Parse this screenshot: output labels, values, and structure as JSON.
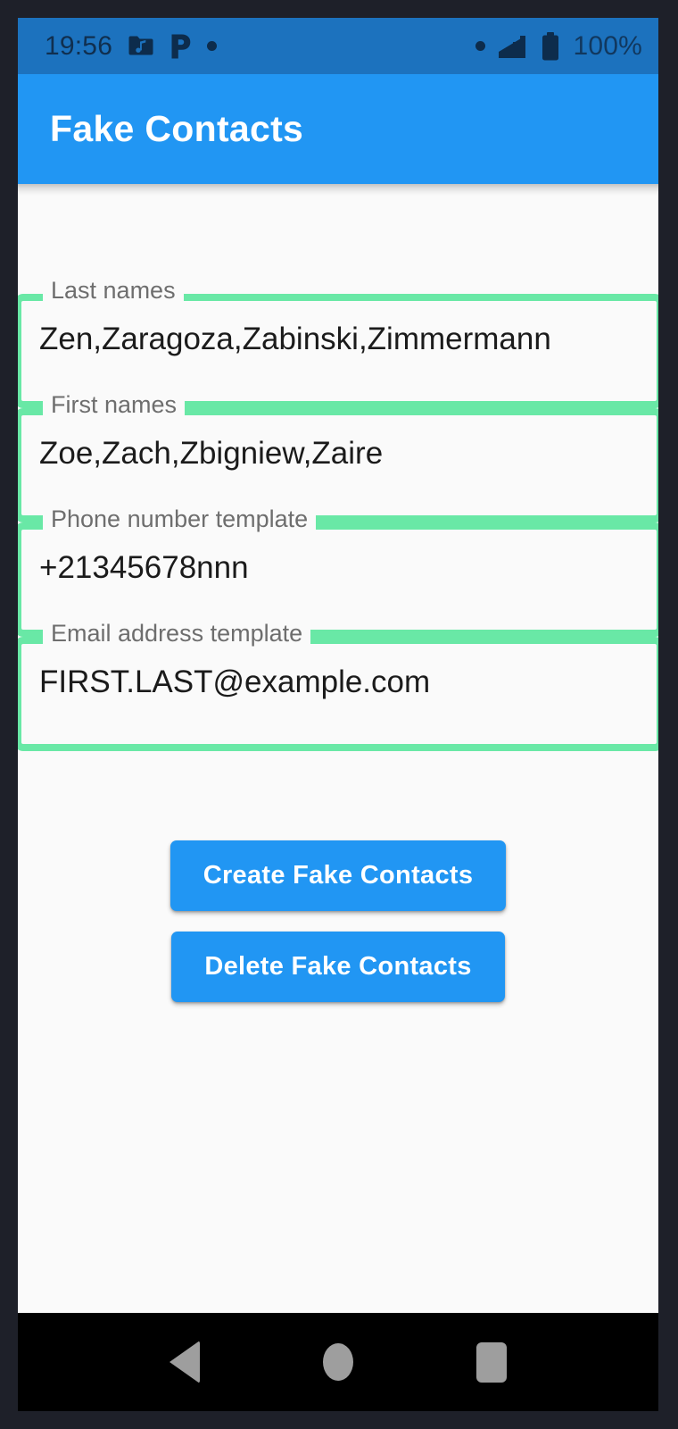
{
  "status_bar": {
    "clock": "19:56",
    "battery_percent": "100%",
    "left_icons": [
      "music-folder-icon",
      "pandora-p-icon",
      "notification-dot-icon"
    ],
    "right_icons": [
      "notification-dot-icon",
      "signal-bars-icon",
      "battery-full-icon"
    ],
    "background_color": "#1C72BE",
    "foreground_color": "#0D2C4C"
  },
  "app_bar": {
    "title": "Fake Contacts",
    "background_color": "#2196F3",
    "title_color": "#FFFFFF"
  },
  "form": {
    "accent_color": "#69E8A6",
    "label_color": "#6E6E6E",
    "fields": [
      {
        "id": "last-names",
        "label": "Last names",
        "value": "Zen,Zaragoza,Zabinski,Zimmermann",
        "placeholder": "Last names"
      },
      {
        "id": "first-names",
        "label": "First names",
        "value": "Zoe,Zach,Zbigniew,Zaire",
        "placeholder": "First names"
      },
      {
        "id": "phone-template",
        "label": "Phone number template",
        "value": "+21345678nnn",
        "placeholder": "Phone number template"
      },
      {
        "id": "email-template",
        "label": "Email address template",
        "value": "FIRST.LAST@example.com",
        "placeholder": "Email address template"
      }
    ]
  },
  "buttons": {
    "create_label": "Create Fake Contacts",
    "delete_label": "Delete Fake Contacts",
    "background_color": "#2196F3",
    "text_color": "#FFFFFF"
  },
  "nav_bar": {
    "back_label": "Back",
    "home_label": "Home",
    "recents_label": "Recent apps",
    "background_color": "#000000",
    "glyph_color": "#9E9E9E"
  }
}
